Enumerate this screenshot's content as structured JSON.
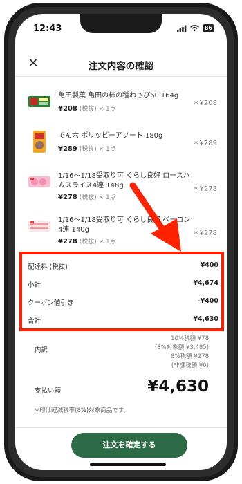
{
  "status": {
    "time": "12:43",
    "battery": "86"
  },
  "header": {
    "title": "注文内容の確認"
  },
  "items": [
    {
      "name": "亀田製菓 亀田の柿の種わさび6P 164g",
      "price": "¥208",
      "qty": "(税抜) × 1点",
      "right": "¥208"
    },
    {
      "name": "でん六 ポリッピーアソート 180g",
      "price": "¥289",
      "qty": "(税抜) × 1点",
      "right": "¥289"
    },
    {
      "name": "1/16〜1/18受取り可 くらし良好 ロースハムスライス4連 148g",
      "price": "¥278",
      "qty": "(税抜) × 1点",
      "right": "¥278"
    },
    {
      "name": "1/16〜1/18受取り可 くらし良好 ベーコン 4連 140g",
      "price": "¥278",
      "qty": "(税抜) × 1点",
      "right": "¥278"
    }
  ],
  "summary": [
    {
      "label": "配達料 (税抜)",
      "value": "¥400"
    },
    {
      "label": "小計",
      "value": "¥4,674"
    },
    {
      "label": "クーポン値引き",
      "value": "-¥400"
    },
    {
      "label": "合計",
      "value": "¥4,630"
    }
  ],
  "breakdown": {
    "label": "内訳",
    "lines": [
      "10%税額 ¥78",
      "(8%対象額 ¥3,485)",
      "8%税額 ¥278",
      "(非課税額 ¥0)"
    ]
  },
  "payment": {
    "label": "支払い額",
    "value": "¥4,630"
  },
  "note": "※印は軽減税率(8%)対象商品です。",
  "confirm_label": "注文を確定する",
  "colors": {
    "accent": "#2d6b47",
    "highlight": "#ff2200"
  }
}
